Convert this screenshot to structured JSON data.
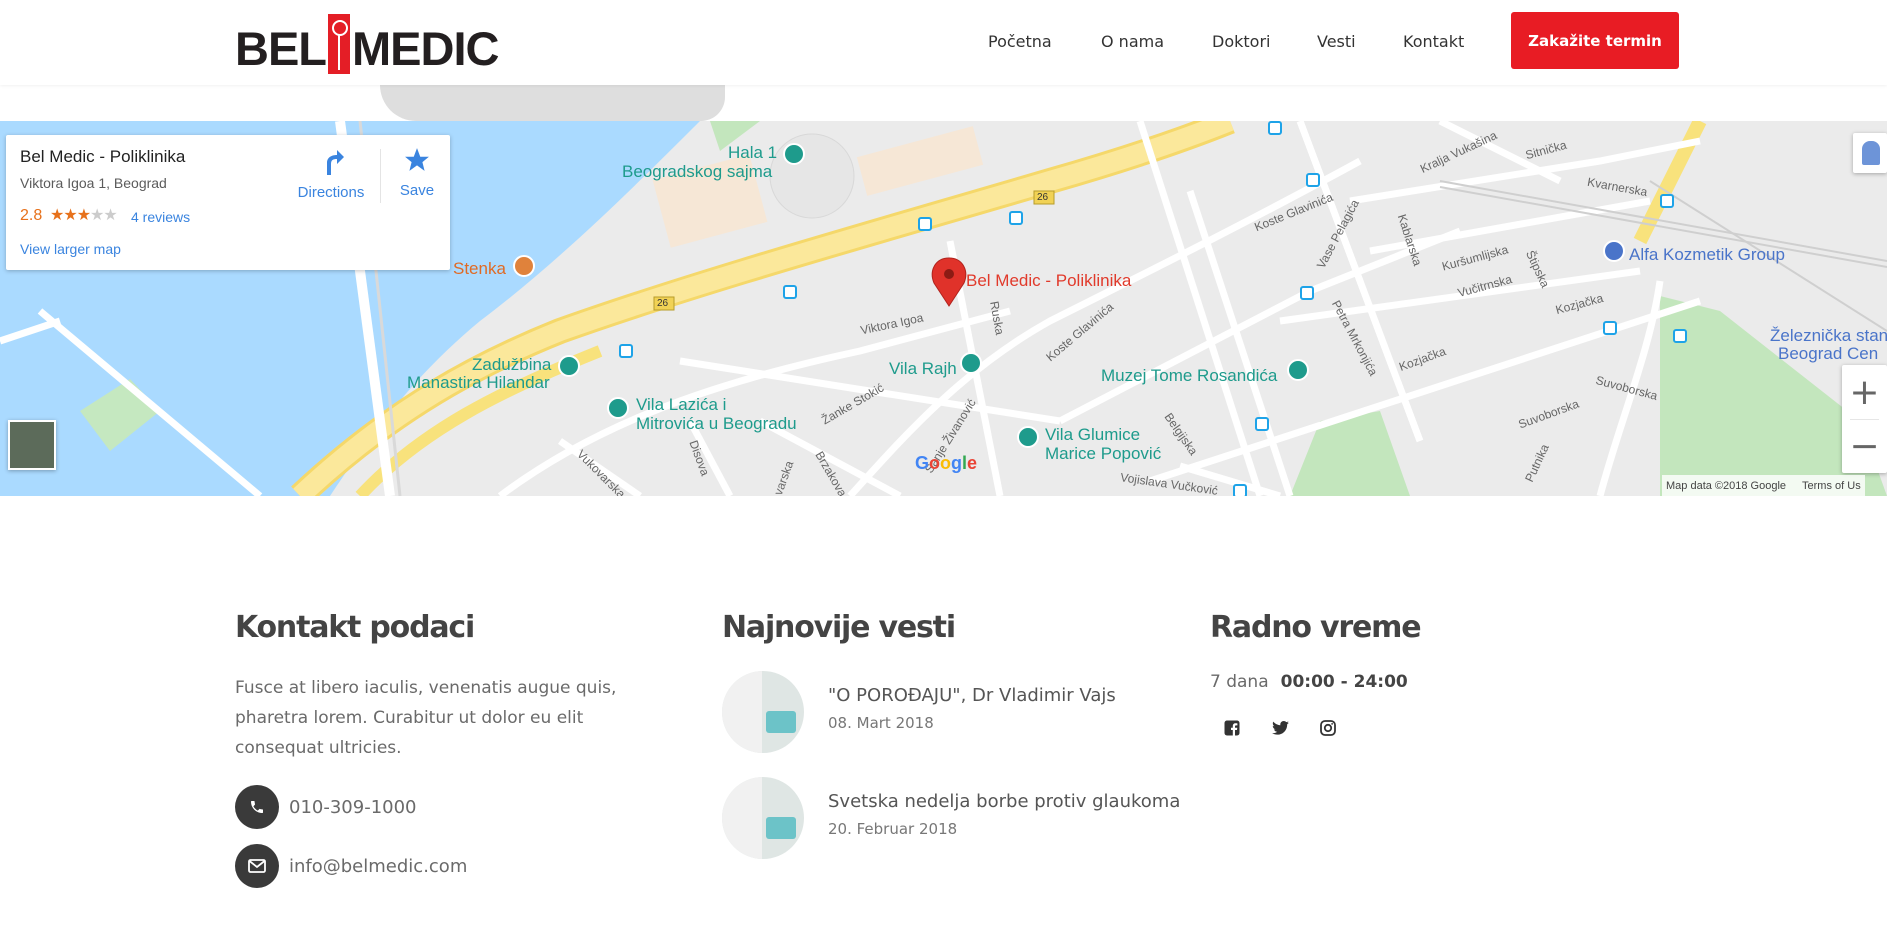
{
  "header": {
    "logo_left": "BEL",
    "logo_right": "MEDIC",
    "nav": [
      "Početna",
      "O nama",
      "Doktori",
      "Vesti",
      "Kontakt"
    ],
    "cta": "Zakažite termin"
  },
  "map": {
    "card": {
      "title": "Bel Medic - Poliklinika",
      "address": "Viktora Igoa 1, Beograd",
      "rating": "2.8",
      "stars": 3,
      "reviews": "4 reviews",
      "larger_map": "View larger map",
      "directions": "Directions",
      "save": "Save"
    },
    "marker_label": "Bel Medic - Poliklinika",
    "places": {
      "hala1a": "Hala 1",
      "hala1b": "Beogradskog sajma",
      "stenka": "Stenka",
      "zaduzbina_a": "Zadužbina",
      "zaduzbina_b": "Manastira Hilandar",
      "lazica_a": "Vila Lazića i",
      "lazica_b": "Mitrovića u Beogradu",
      "rajh": "Vila Rajh",
      "muzej": "Muzej Tome Rosandića",
      "glumice_a": "Vila Glumice",
      "glumice_b": "Marice Popović",
      "alfa": "Alfa Kozmetik Group",
      "zeleznicka_a": "Železnička stan",
      "zeleznicka_b": "Beograd Cen"
    },
    "streets": {
      "viktora": "Viktora Igoa",
      "ruska": "Ruska",
      "koste1": "Koste Glavinića",
      "koste2": "Koste Glavinića",
      "vase": "Vase Pelagića",
      "kablarska": "Kablarska",
      "kursumlijska": "Kuršumlijska",
      "vucitrnska": "Vučitrnska",
      "stipska": "Štipska",
      "kozjacka1": "Kozjačka",
      "kozjacka2": "Kozjačka",
      "kraljavukasina": "Kralja Vukašina",
      "sitnicka": "Sitnička",
      "kvarnerska": "Kvarnerska",
      "petra": "Petra Mrkonjića",
      "suvoborska1": "Suvoborska",
      "suvoborska2": "Suvoborska",
      "beljska": "Belgijska",
      "vojislava": "Vojislava Vučković",
      "putnika": "Putnika",
      "zanke": "Žanke Stokić",
      "sanje": "Sanje Živanović",
      "disova": "Disova",
      "vukovarska": "Vukovarska",
      "varska": "varska",
      "brzakova": "Brzakova",
      "route26a": "26",
      "route26b": "26"
    },
    "google": "Google",
    "attribution": "Map data ©2018 Google",
    "terms": "Terms of Us"
  },
  "footer": {
    "contact": {
      "title": "Kontakt podaci",
      "description": "Fusce at libero iaculis, venenatis augue quis, pharetra lorem. Curabitur ut dolor eu elit consequat ultricies.",
      "phone": "010-309-1000",
      "email": "info@belmedic.com"
    },
    "news": {
      "title": "Najnovije vesti",
      "items": [
        {
          "title": "\"O POROĐAJU\", Dr Vladimir Vajs",
          "date": "08. Mart 2018"
        },
        {
          "title": "Svetska nedelja borbe protiv glaukoma",
          "date": "20. Februar 2018"
        }
      ]
    },
    "hours": {
      "title": "Radno vreme",
      "days": "7 dana",
      "time": "00:00 - 24:00"
    }
  },
  "colors": {
    "brand_red": "#e81c24",
    "link_blue": "#3a84df",
    "poi_teal": "#1e9b8c",
    "water": "#aadaff",
    "highway": "#f8e27c"
  },
  "icons": [
    "phone-icon",
    "envelope-icon",
    "facebook-icon",
    "twitter-icon",
    "instagram-icon",
    "directions-icon",
    "star-icon",
    "map-marker-icon",
    "zoom-in-icon",
    "zoom-out-icon",
    "pegman-icon"
  ]
}
